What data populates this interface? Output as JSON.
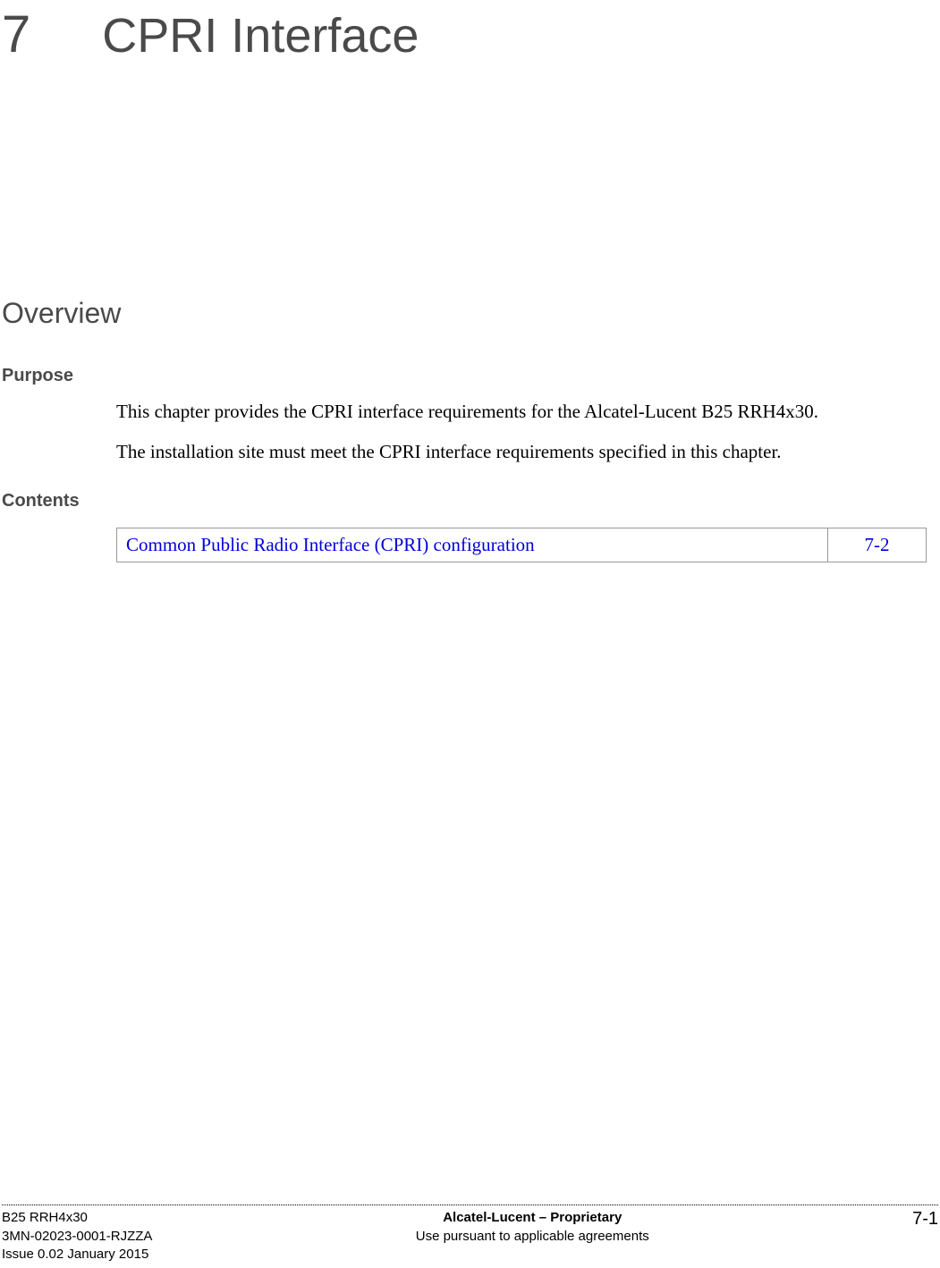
{
  "chapter": {
    "number": "7",
    "title": "CPRI Interface"
  },
  "overview": {
    "title": "Overview",
    "purpose": {
      "heading": "Purpose",
      "paragraph1": "This chapter provides the CPRI interface requirements for the Alcatel-Lucent B25 RRH4x30.",
      "paragraph2": "The installation site must meet the CPRI interface requirements specified in this chapter."
    },
    "contents": {
      "heading": "Contents",
      "items": [
        {
          "label": "Common Public Radio Interface (CPRI) configuration",
          "page": "7-2"
        }
      ]
    }
  },
  "footer": {
    "left_line1": "B25 RRH4x30",
    "left_line2": "3MN-02023-0001-RJZZA",
    "left_line3": "Issue 0.02   January 2015",
    "center_line1": "Alcatel-Lucent – Proprietary",
    "center_line2": "Use pursuant to applicable agreements",
    "right": "7-1"
  }
}
